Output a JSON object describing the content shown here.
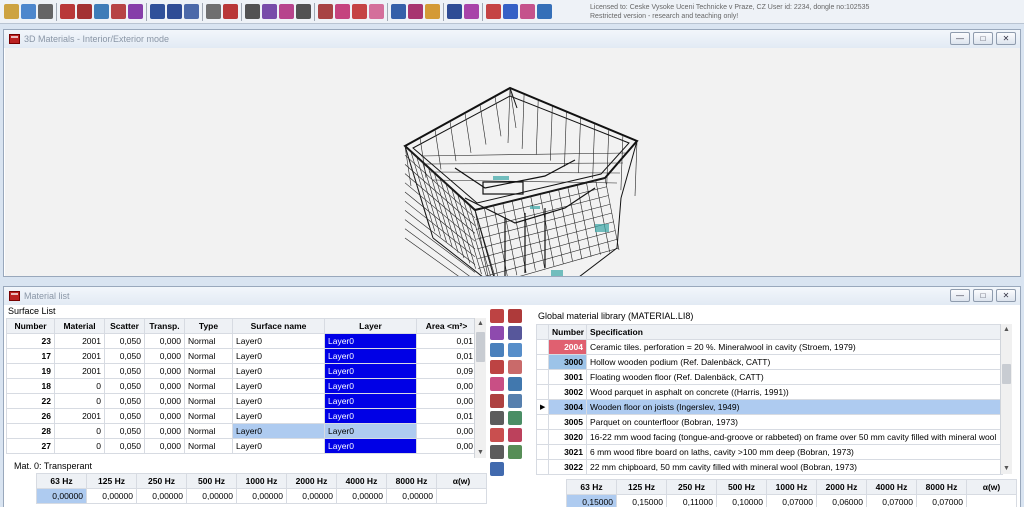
{
  "app": {
    "license_line1": "Licensed to: Ceske Vysoke Uceni Technicke v Praze, CZ   User id: 2234, dongle no:102535",
    "license_line2": "Restricted version - research and teaching only!"
  },
  "toolbar_icons": [
    {
      "name": "open-icon",
      "color": "#c99a2e"
    },
    {
      "name": "image-icon",
      "color": "#3b7bc8"
    },
    {
      "name": "print-icon",
      "color": "#555555"
    },
    {
      "name": "window-red-icon",
      "color": "#b22222"
    },
    {
      "name": "report-icon",
      "color": "#9a1c1c"
    },
    {
      "name": "chart-icon",
      "color": "#2a6fb0"
    },
    {
      "name": "tools-icon",
      "color": "#b03030"
    },
    {
      "name": "gif-icon",
      "color": "#7a2aa0"
    },
    {
      "name": "info-icon",
      "color": "#1b3f8f"
    },
    {
      "name": "material-icon",
      "color": "#1a3a8a"
    },
    {
      "name": "notes-icon",
      "color": "#3a5aa0"
    },
    {
      "name": "drum-icon",
      "color": "#606060"
    },
    {
      "name": "grid-icon",
      "color": "#b22222"
    },
    {
      "name": "walk-icon",
      "color": "#404040"
    },
    {
      "name": "edit-icon",
      "color": "#6a3aa0"
    },
    {
      "name": "ray-icon",
      "color": "#b03080"
    },
    {
      "name": "curve-icon",
      "color": "#404040"
    },
    {
      "name": "angle-icon",
      "color": "#a03030"
    },
    {
      "name": "cube-icon",
      "color": "#c03070"
    },
    {
      "name": "spectrum-icon",
      "color": "#c03030"
    },
    {
      "name": "scatter-icon",
      "color": "#d06090"
    },
    {
      "name": "panel-icon",
      "color": "#2050a0"
    },
    {
      "name": "frames-icon",
      "color": "#a02060"
    },
    {
      "name": "tools2-icon",
      "color": "#d09020"
    },
    {
      "name": "check-icon",
      "color": "#1a3a8a"
    },
    {
      "name": "chart2-icon",
      "color": "#a030a0"
    },
    {
      "name": "wave-icon",
      "color": "#c03030"
    },
    {
      "name": "play-icon",
      "color": "#2050c0"
    },
    {
      "name": "link-icon",
      "color": "#c04080"
    },
    {
      "name": "help-icon",
      "color": "#2060b0"
    }
  ],
  "window_3d": {
    "title": "3D Materials - Interior/Exterior mode"
  },
  "material_window": {
    "title": "Material list"
  },
  "surface_list": {
    "label": "Surface List",
    "columns": [
      "Number",
      "Material",
      "Scatter",
      "Transp.",
      "Type",
      "Surface name",
      "Layer",
      "Area <m²>"
    ],
    "rows": [
      [
        "23",
        "2001",
        "0,050",
        "0,000",
        "Normal",
        "Layer0",
        "Layer0",
        "0,01"
      ],
      [
        "17",
        "2001",
        "0,050",
        "0,000",
        "Normal",
        "Layer0",
        "Layer0",
        "0,01"
      ],
      [
        "19",
        "2001",
        "0,050",
        "0,000",
        "Normal",
        "Layer0",
        "Layer0",
        "0,09"
      ],
      [
        "18",
        "0",
        "0,050",
        "0,000",
        "Normal",
        "Layer0",
        "Layer0",
        "0,00"
      ],
      [
        "22",
        "0",
        "0,050",
        "0,000",
        "Normal",
        "Layer0",
        "Layer0",
        "0,00"
      ],
      [
        "26",
        "2001",
        "0,050",
        "0,000",
        "Normal",
        "Layer0",
        "Layer0",
        "0,01"
      ],
      [
        "28",
        "0",
        "0,050",
        "0,000",
        "Normal",
        "Layer0",
        "Layer0",
        "0,00"
      ],
      [
        "27",
        "0",
        "0,050",
        "0,000",
        "Normal",
        "Layer0",
        "Layer0",
        "0,00"
      ]
    ]
  },
  "mat_info": {
    "label": "Mat. 0: Transperant",
    "columns": [
      "63 Hz",
      "125 Hz",
      "250 Hz",
      "500 Hz",
      "1000 Hz",
      "2000 Hz",
      "4000 Hz",
      "8000 Hz",
      "α(w)"
    ],
    "values": [
      "0,00000",
      "0,00000",
      "0,00000",
      "0,00000",
      "0,00000",
      "0,00000",
      "0,00000",
      "0,00000",
      ""
    ]
  },
  "library": {
    "label": "Global material library (MATERIAL.LI8)",
    "columns": [
      "Number",
      "Specification"
    ],
    "rows": [
      [
        "2004",
        "Ceramic tiles. perforation = 20 %. Mineralwool in cavity (Stroem, 1979)"
      ],
      [
        "3000",
        "Hollow wooden podium (Ref. Dalenbäck, CATT)"
      ],
      [
        "3001",
        "Floating wooden floor (Ref. Dalenbäck, CATT)"
      ],
      [
        "3002",
        "Wood parquet in asphalt on concrete ((Harris, 1991))"
      ],
      [
        "3004",
        "Wooden floor on joists (Ingerslev, 1949)"
      ],
      [
        "3005",
        "Parquet on counterfloor (Bobran, 1973)"
      ],
      [
        "3020",
        "16-22 mm wood facing (tongue-and-groove or rabbeted) on frame over 50 mm cavity filled with mineral wool"
      ],
      [
        "3021",
        "6 mm wood fibre board on laths, cavity >100 mm deep (Bobran, 1973)"
      ],
      [
        "3022",
        "22 mm chipboard, 50 mm cavity filled with mineral wool (Bobran, 1973)"
      ]
    ],
    "freq_columns": [
      "63 Hz",
      "125 Hz",
      "250 Hz",
      "500 Hz",
      "1000 Hz",
      "2000 Hz",
      "4000 Hz",
      "8000 Hz",
      "α(w)"
    ],
    "freq_values": [
      "0,15000",
      "0,15000",
      "0,11000",
      "0,10000",
      "0,07000",
      "0,06000",
      "0,07000",
      "0,07000",
      ""
    ]
  },
  "side_icons": [
    {
      "name": "layer-red-icon",
      "color": "#b22222"
    },
    {
      "name": "layer-red2-icon",
      "color": "#a01818"
    },
    {
      "name": "chart-icon",
      "color": "#7a2aa0"
    },
    {
      "name": "grid-icon",
      "color": "#3a3a8a"
    },
    {
      "name": "globe-icon",
      "color": "#2a6ab0"
    },
    {
      "name": "globe2-icon",
      "color": "#3a7ac0"
    },
    {
      "name": "cube-icon",
      "color": "#b22222"
    },
    {
      "name": "wand-icon",
      "color": "#c05050"
    },
    {
      "name": "layers-icon",
      "color": "#c03070"
    },
    {
      "name": "stack-icon",
      "color": "#2060a0"
    },
    {
      "name": "pin-icon",
      "color": "#a02020"
    },
    {
      "name": "grid2-icon",
      "color": "#3a6aa0"
    },
    {
      "name": "delete-icon",
      "color": "#404040"
    },
    {
      "name": "image-icon",
      "color": "#2a7a4a"
    },
    {
      "name": "refresh-icon",
      "color": "#c03030"
    },
    {
      "name": "cross-icon",
      "color": "#b02040"
    },
    {
      "name": "binoculars-icon",
      "color": "#404040"
    },
    {
      "name": "house-icon",
      "color": "#3a7a3a"
    },
    {
      "name": "grid3-icon",
      "color": "#2050a0"
    }
  ]
}
